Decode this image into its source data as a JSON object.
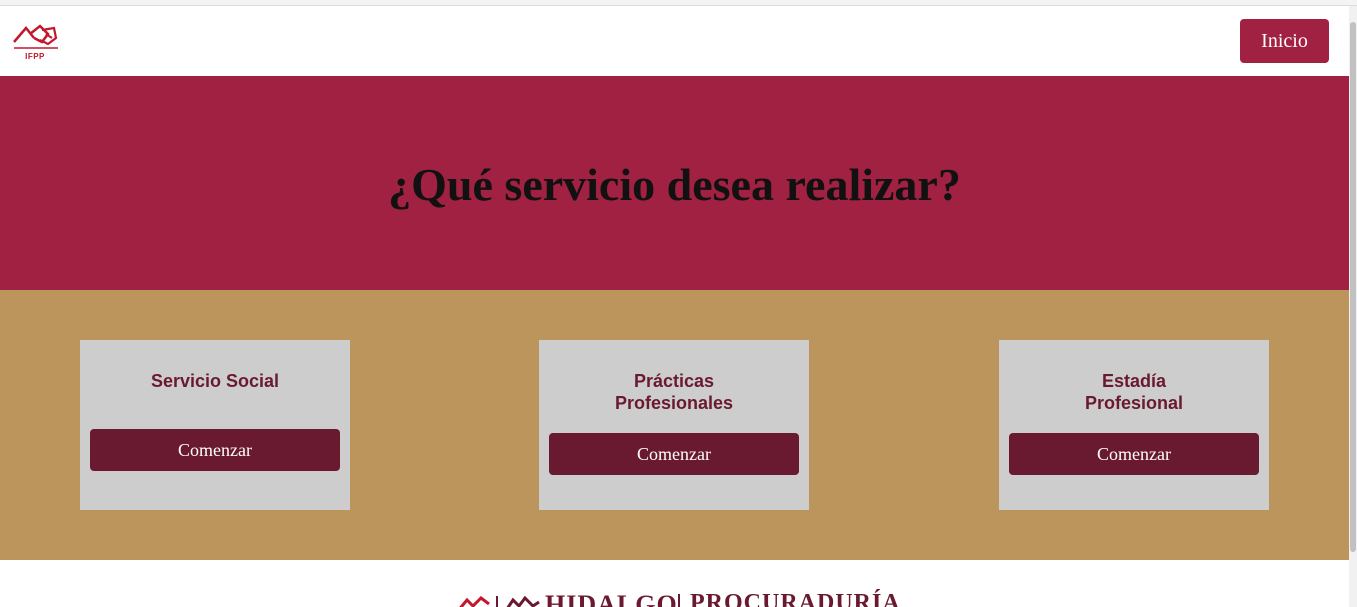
{
  "navbar": {
    "logo_text": "IFPP",
    "inicio_label": "Inicio"
  },
  "hero": {
    "title": "¿Qué servicio desea realizar?"
  },
  "services": [
    {
      "title_line1": "Servicio Social",
      "title_line2": "",
      "button_label": "Comenzar"
    },
    {
      "title_line1": "Prácticas",
      "title_line2": "Profesionales",
      "button_label": "Comenzar"
    },
    {
      "title_line1": "Estadía",
      "title_line2": "Profesional",
      "button_label": "Comenzar"
    }
  ],
  "footer": {
    "hidalgo_text": "HIDALGO",
    "procuraduria_text": "PROCURADURÍA"
  },
  "colors": {
    "primary": "#a12142",
    "dark_primary": "#6a1a30",
    "gold": "#bc955c",
    "card_bg": "#cdcdcd"
  }
}
